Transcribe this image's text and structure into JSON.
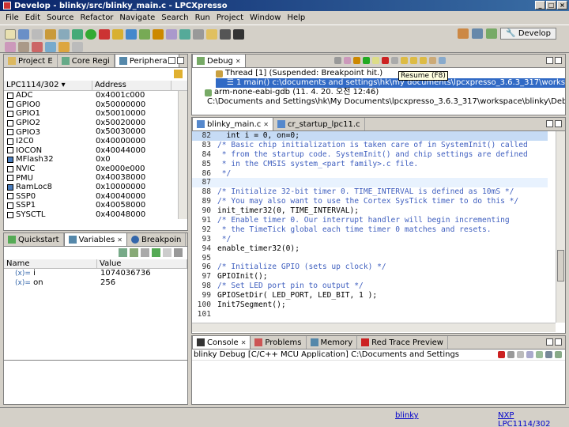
{
  "window": {
    "title": "Develop - blinky/src/blinky_main.c - LPCXpresso",
    "controls": [
      "_",
      "□",
      "×"
    ]
  },
  "menu": [
    "File",
    "Edit",
    "Source",
    "Refactor",
    "Navigate",
    "Search",
    "Run",
    "Project",
    "Window",
    "Help"
  ],
  "perspective": {
    "label": "Develop"
  },
  "left_top": {
    "tabs": [
      {
        "label": "Project E"
      },
      {
        "label": "Core Regi"
      },
      {
        "label": "Periphera",
        "active": true
      }
    ],
    "selector": "LPC1114/302",
    "address_header": "Address",
    "peripherals": [
      {
        "name": "ADC",
        "address": "0x4001c000"
      },
      {
        "name": "GPIO0",
        "address": "0x50000000"
      },
      {
        "name": "GPIO1",
        "address": "0x50010000"
      },
      {
        "name": "GPIO2",
        "address": "0x50020000"
      },
      {
        "name": "GPIO3",
        "address": "0x50030000"
      },
      {
        "name": "I2C0",
        "address": "0x40000000"
      },
      {
        "name": "IOCON",
        "address": "0x40044000"
      },
      {
        "name": "MFlash32",
        "address": "0x0"
      },
      {
        "name": "NVIC",
        "address": "0xe000e000"
      },
      {
        "name": "PMU",
        "address": "0x40038000"
      },
      {
        "name": "RamLoc8",
        "address": "0x10000000"
      },
      {
        "name": "SSP0",
        "address": "0x40040000"
      },
      {
        "name": "SSP1",
        "address": "0x40058000"
      },
      {
        "name": "SYSCTL",
        "address": "0x40048000"
      }
    ]
  },
  "left_bottom": {
    "tabs": [
      {
        "label": "Quickstart"
      },
      {
        "label": "Variables",
        "active": true
      },
      {
        "label": "Breakpoin"
      }
    ],
    "columns": [
      "Name",
      "Value"
    ],
    "variables": [
      {
        "name": "i",
        "value": "1074036736"
      },
      {
        "name": "on",
        "value": "256"
      }
    ]
  },
  "debug": {
    "tab": "Debug",
    "lines": [
      "Thread [1] (Suspended: Breakpoint hit.)",
      "1 main() c:\\documents and settings\\hk\\my documents\\lpcxpresso_3.6.3_317\\workspace\\b",
      "arm-none-eabi-gdb (11. 4. 20. 오전 12:46)",
      "C:\\Documents and Settings\\hk\\My Documents\\lpcxpresso_3.6.3_317\\workspace\\blinky\\Debug\\"
    ],
    "tooltip": "Resume (F8)"
  },
  "editor": {
    "tabs": [
      {
        "label": "blinky_main.c",
        "active": true
      },
      {
        "label": "cr_startup_lpc11.c"
      }
    ],
    "lines": [
      {
        "n": "82",
        "code": "  int i = 0, on=0;",
        "type": "code",
        "current": true
      },
      {
        "n": "83",
        "code": "/* Basic chip initialization is taken care of in SystemInit() called",
        "type": "comment"
      },
      {
        "n": "84",
        "code": " * from the startup code. SystemInit() and chip settings are defined",
        "type": "comment"
      },
      {
        "n": "85",
        "code": " * in the CMSIS system_<part family>.c file.",
        "type": "comment"
      },
      {
        "n": "86",
        "code": " */",
        "type": "comment"
      },
      {
        "n": "87",
        "code": "",
        "type": "code",
        "highlight": true
      },
      {
        "n": "88",
        "code": "/* Initialize 32-bit timer 0. TIME_INTERVAL is defined as 10mS */",
        "type": "comment"
      },
      {
        "n": "89",
        "code": "/* You may also want to use the Cortex SysTick timer to do this */",
        "type": "comment"
      },
      {
        "n": "90",
        "code": "init_timer32(0, TIME_INTERVAL);",
        "type": "code"
      },
      {
        "n": "91",
        "code": "/* Enable timer 0. Our interrupt handler will begin incrementing",
        "type": "comment"
      },
      {
        "n": "92",
        "code": " * the TimeTick global each time timer 0 matches and resets.",
        "type": "comment"
      },
      {
        "n": "93",
        "code": " */",
        "type": "comment"
      },
      {
        "n": "94",
        "code": "enable_timer32(0);",
        "type": "code"
      },
      {
        "n": "95",
        "code": "",
        "type": "code"
      },
      {
        "n": "96",
        "code": "/* Initialize GPIO (sets up clock) */",
        "type": "comment"
      },
      {
        "n": "97",
        "code": "GPIOInit();",
        "type": "code"
      },
      {
        "n": "98",
        "code": "/* Set LED port pin to output */",
        "type": "comment"
      },
      {
        "n": "99",
        "code": "GPIOSetDir( LED_PORT, LED_BIT, 1 );",
        "type": "code"
      },
      {
        "n": "100",
        "code": "Init7Segment();",
        "type": "code"
      },
      {
        "n": "101",
        "code": "",
        "type": "code"
      }
    ]
  },
  "console": {
    "tabs": [
      {
        "label": "Console",
        "active": true
      },
      {
        "label": "Problems"
      },
      {
        "label": "Memory"
      },
      {
        "label": "Red Trace Preview"
      }
    ],
    "header": "blinky Debug [C/C++ MCU Application] C:\\Documents and Settings"
  },
  "status": {
    "project": "blinky",
    "target": "NXP LPC1114/302"
  },
  "colors": {
    "titlebar": "#0a246a",
    "comment": "#3f5fbf",
    "current_line": "#c6dbf5",
    "link": "#0000cc"
  }
}
